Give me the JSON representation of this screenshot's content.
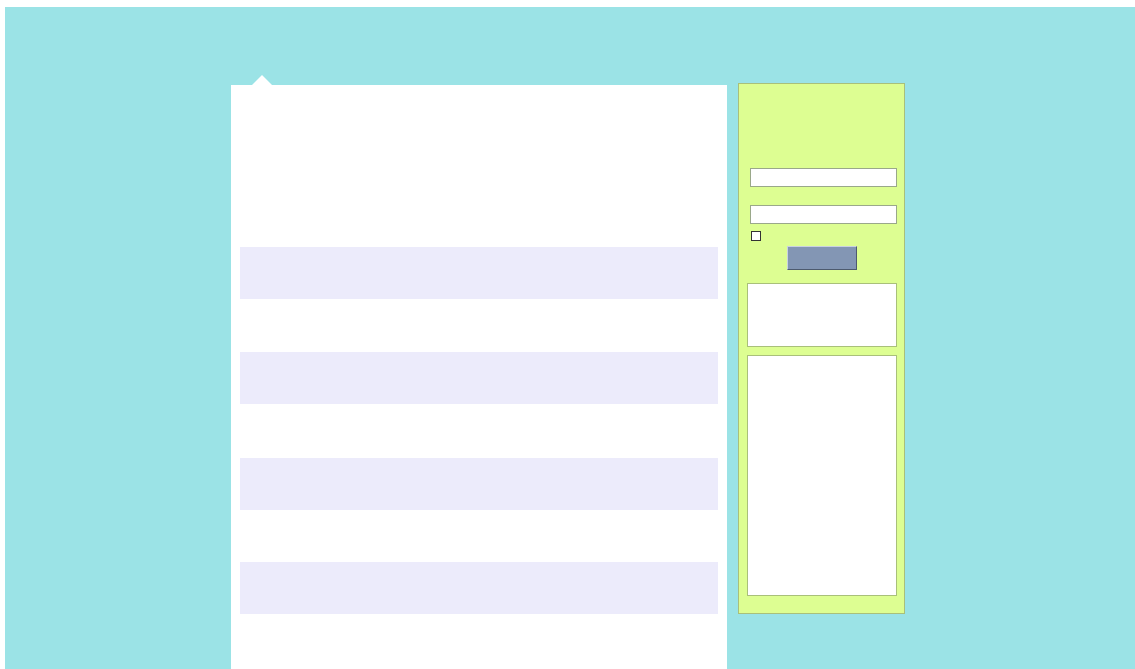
{
  "page": {
    "background_color": "#9be3e6",
    "main_panel_color": "#ffffff",
    "row_color": "#ecebfb",
    "sidebar_color": "#ddfe92",
    "button_color": "#8396b4"
  },
  "main": {
    "rows": [
      {
        "text": ""
      },
      {
        "text": ""
      },
      {
        "text": ""
      },
      {
        "text": ""
      }
    ]
  },
  "sidebar": {
    "login_form": {
      "username_value": "",
      "password_value": "",
      "remember_checked": false,
      "submit_label": ""
    },
    "info_box_text": "",
    "list_box_text": ""
  }
}
